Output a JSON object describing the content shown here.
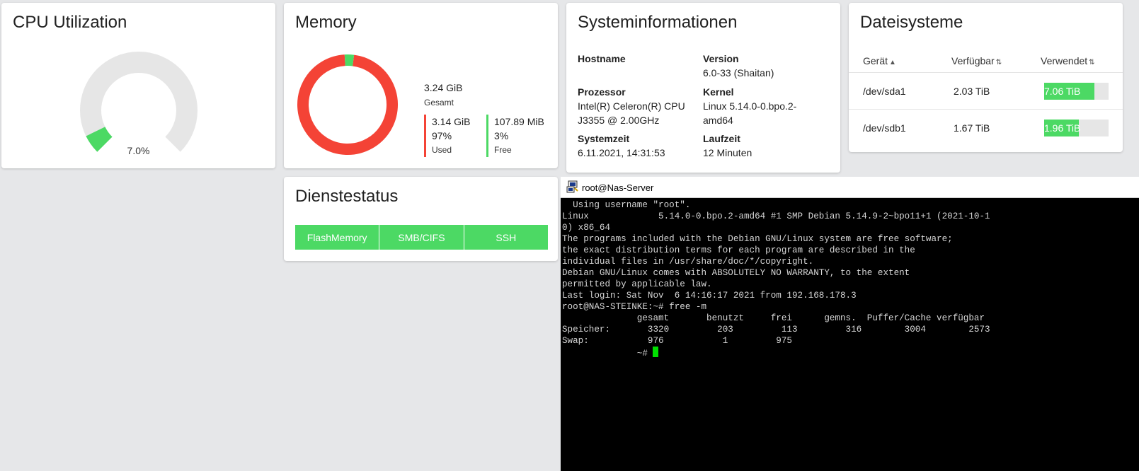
{
  "cpu": {
    "title": "CPU Utilization",
    "value_label": "7.0%",
    "utilization_percent": 7.0,
    "colors": {
      "fill": "#4cd964",
      "track": "#e6e6e6"
    }
  },
  "memory": {
    "title": "Memory",
    "total": "3.24 GiB",
    "total_label": "Gesamt",
    "used": {
      "value": "3.14 GiB",
      "percent": "97%",
      "label": "Used",
      "fraction": 0.97,
      "color": "#f44336"
    },
    "free": {
      "value": "107.89 MiB",
      "percent": "3%",
      "label": "Free",
      "fraction": 0.03,
      "color": "#4cd964"
    }
  },
  "system": {
    "title": "Systeminformationen",
    "hostname_label": "Hostname",
    "hostname": "",
    "version_label": "Version",
    "version": "6.0-33 (Shaitan)",
    "processor_label": "Prozessor",
    "processor": "Intel(R) Celeron(R) CPU J3355 @ 2.00GHz",
    "kernel_label": "Kernel",
    "kernel": "Linux 5.14.0-0.bpo.2-amd64",
    "systime_label": "Systemzeit",
    "systime": "6.11.2021, 14:31:53",
    "uptime_label": "Laufzeit",
    "uptime": "12 Minuten"
  },
  "filesystems": {
    "title": "Dateisysteme",
    "columns": {
      "device": "Gerät",
      "available": "Verfügbar",
      "used": "Verwendet"
    },
    "rows": [
      {
        "device": "/dev/sda1",
        "available": "2.03 TiB",
        "used": "7.06 TiB",
        "used_fraction": 0.78
      },
      {
        "device": "/dev/sdb1",
        "available": "1.67 TiB",
        "used": "1.96 TiB",
        "used_fraction": 0.54
      }
    ]
  },
  "services": {
    "title": "Dienstestatus",
    "items": [
      {
        "label": "FlashMemory",
        "color": "#4cd964"
      },
      {
        "label": "SMB/CIFS",
        "color": "#4cd964"
      },
      {
        "label": "SSH",
        "color": "#4cd964"
      }
    ]
  },
  "terminal": {
    "title": "root@Nas-Server",
    "lines": [
      "  Using username \"root\".",
      "Linux             5.14.0-0.bpo.2-amd64 #1 SMP Debian 5.14.9-2~bpo11+1 (2021-10-1",
      "0) x86_64",
      "",
      "The programs included with the Debian GNU/Linux system are free software;",
      "the exact distribution terms for each program are described in the",
      "individual files in /usr/share/doc/*/copyright.",
      "",
      "Debian GNU/Linux comes with ABSOLUTELY NO WARRANTY, to the extent",
      "permitted by applicable law.",
      "Last login: Sat Nov  6 14:16:17 2021 from 192.168.178.3",
      "root@NAS-STEINKE:~# free -m",
      "              gesamt       benutzt     frei      gemns.  Puffer/Cache verfügbar",
      "Speicher:       3320         203         113         316        3004        2573",
      "Swap:           976           1         975"
    ],
    "prompt": "              ~# "
  }
}
